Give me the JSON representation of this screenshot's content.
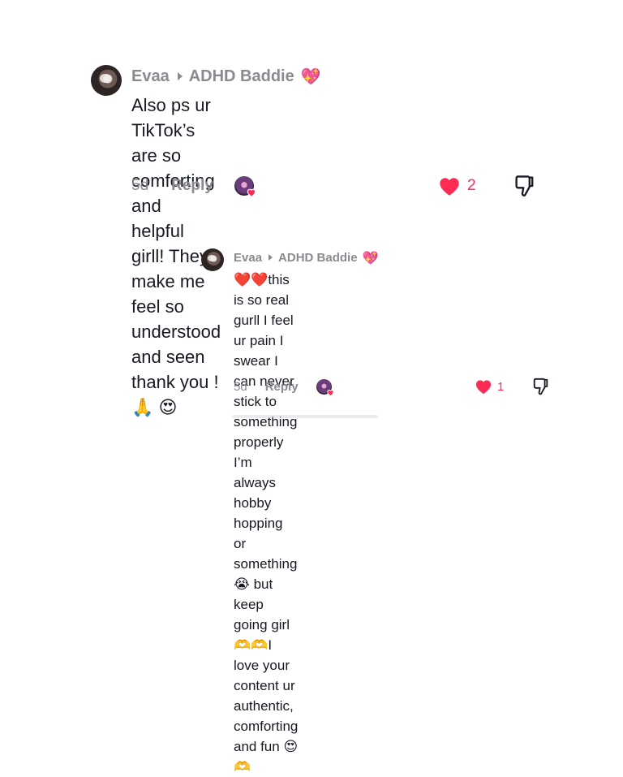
{
  "comment1": {
    "author": "Evaa",
    "reply_to": "ADHD Baddie",
    "heart_emoji": "💖",
    "lines": [
      "Also ps ur TikTok’s are so comforting and",
      "helpful girll! They make me feel so understood",
      "and seen thank you !🙏 😍"
    ],
    "age": "5d",
    "reply_label": "Reply",
    "likes": "2"
  },
  "comment2": {
    "author": "Evaa",
    "reply_to": "ADHD Baddie",
    "heart_emoji": "💖",
    "lines": [
      "❤️❤️this is so real gurll I feel ur pain I swear I",
      "can never stick to something properly I’m",
      "always hobby hopping or something 😭 but",
      "keep going girl 🫶🫶I love your content ur",
      "authentic, comforting and fun 😍🫶"
    ],
    "age": "5d",
    "reply_label": "Reply",
    "likes": "1"
  },
  "colors": {
    "accent": "#fe2c55",
    "muted": "#8a8b91",
    "text": "#161823"
  },
  "icons": {
    "like": "heart-filled-icon",
    "dislike": "thumbs-down-icon",
    "caret": "caret-right-icon"
  }
}
